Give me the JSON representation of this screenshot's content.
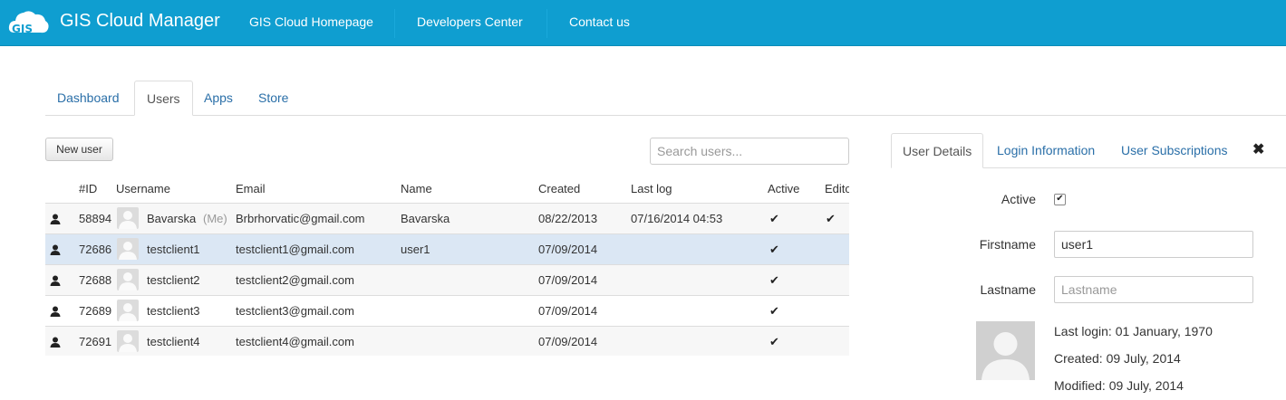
{
  "header": {
    "logo_text": "GIS",
    "brand": "GIS Cloud Manager",
    "nav": [
      "GIS Cloud Homepage",
      "Developers Center",
      "Contact us"
    ]
  },
  "tabs": [
    "Dashboard",
    "Users",
    "Apps",
    "Store"
  ],
  "active_tab": "Users",
  "toolbar": {
    "new_user_label": "New user",
    "search_placeholder": "Search users..."
  },
  "table": {
    "columns": [
      "#ID",
      "Username",
      "Email",
      "Name",
      "Created",
      "Last log",
      "Active",
      "Editor"
    ],
    "rows": [
      {
        "id": "58894",
        "username": "Bavarska",
        "suffix": "(Me)",
        "email": "Brbrhorvatic@gmail.com",
        "name": "Bavarska",
        "created": "08/22/2013",
        "last_log": "07/16/2014 04:53",
        "active": "✔",
        "editor": "✔"
      },
      {
        "id": "72686",
        "username": "testclient1",
        "suffix": "",
        "email": "testclient1@gmail.com",
        "name": "user1",
        "created": "07/09/2014",
        "last_log": "",
        "active": "✔",
        "editor": ""
      },
      {
        "id": "72688",
        "username": "testclient2",
        "suffix": "",
        "email": "testclient2@gmail.com",
        "name": "",
        "created": "07/09/2014",
        "last_log": "",
        "active": "✔",
        "editor": ""
      },
      {
        "id": "72689",
        "username": "testclient3",
        "suffix": "",
        "email": "testclient3@gmail.com",
        "name": "",
        "created": "07/09/2014",
        "last_log": "",
        "active": "✔",
        "editor": ""
      },
      {
        "id": "72691",
        "username": "testclient4",
        "suffix": "",
        "email": "testclient4@gmail.com",
        "name": "",
        "created": "07/09/2014",
        "last_log": "",
        "active": "✔",
        "editor": ""
      }
    ],
    "selected_row": 1
  },
  "details": {
    "tabs": [
      "User Details",
      "Login Information",
      "User Subscriptions"
    ],
    "close_glyph": "✖",
    "active_label": "Active",
    "active_checked": "✔",
    "firstname_label": "Firstname",
    "firstname_value": "user1",
    "lastname_label": "Lastname",
    "lastname_placeholder": "Lastname",
    "last_login": "Last login: 01 January, 1970",
    "created": "Created: 09 July, 2014",
    "modified": "Modified: 09 July, 2014"
  },
  "colors": {
    "header": "#0f9ed0",
    "link": "#2a6fa8",
    "selected_row": "#dbe7f4"
  },
  "icons": [
    "gis-cloud-logo-icon",
    "user-icon",
    "avatar-placeholder-icon",
    "check-icon",
    "close-icon"
  ]
}
